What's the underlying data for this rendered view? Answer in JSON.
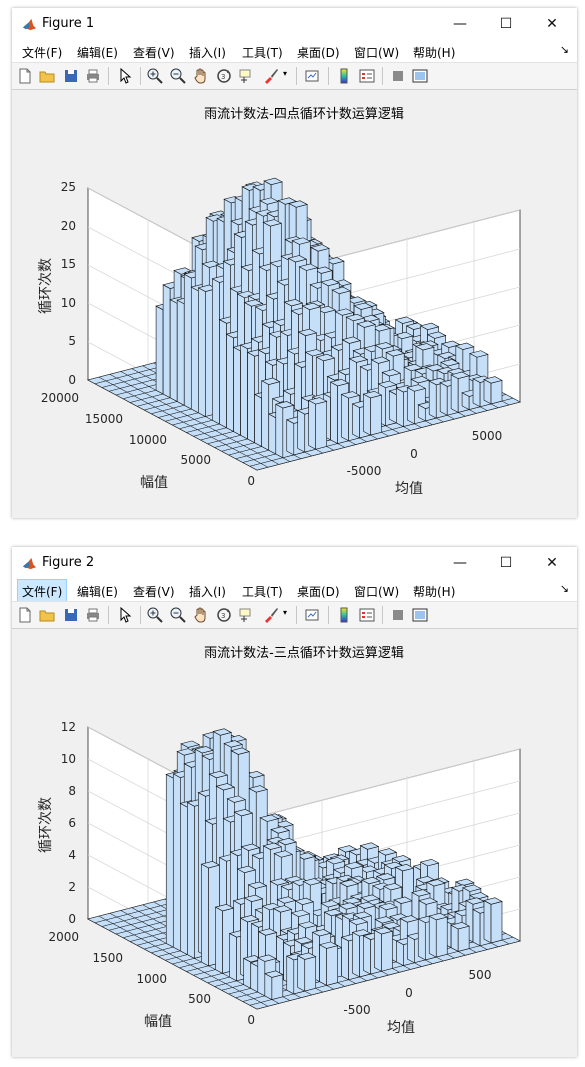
{
  "figures": [
    {
      "window_title": "Figure 1",
      "menu": [
        "文件(F)",
        "编辑(E)",
        "查看(V)",
        "插入(I)",
        "工具(T)",
        "桌面(D)",
        "窗口(W)",
        "帮助(H)"
      ],
      "plot": {
        "title": "雨流计数法-四点循环计数运算逻辑",
        "zlabel": "循环次数",
        "xlabel": "均值",
        "ylabel": "幅值",
        "z_ticks": [
          "0",
          "5",
          "10",
          "15",
          "20",
          "25"
        ],
        "amp_ticks": [
          "20000",
          "15000",
          "10000",
          "5000",
          "0"
        ],
        "mean_ticks": [
          "-5000",
          "0",
          "5000"
        ]
      }
    },
    {
      "window_title": "Figure 2",
      "menu": [
        "文件(F)",
        "编辑(E)",
        "查看(V)",
        "插入(I)",
        "工具(T)",
        "桌面(D)",
        "窗口(W)",
        "帮助(H)"
      ],
      "plot": {
        "title": "雨流计数法-三点循环计数运算逻辑",
        "zlabel": "循环次数",
        "xlabel": "均值",
        "ylabel": "幅值",
        "z_ticks": [
          "0",
          "2",
          "4",
          "6",
          "8",
          "10",
          "12"
        ],
        "amp_ticks": [
          "2000",
          "1500",
          "1000",
          "500",
          "0"
        ],
        "mean_ticks": [
          "-500",
          "0",
          "500"
        ]
      }
    }
  ],
  "toolbar_icons": [
    "new-file-icon",
    "open-folder-icon",
    "save-icon",
    "print-icon",
    "pointer-icon",
    "zoom-in-icon",
    "zoom-out-icon",
    "pan-hand-icon",
    "rotate-3d-icon",
    "data-cursor-icon",
    "brush-icon",
    "link-plot-icon",
    "colorbar-icon",
    "legend-icon",
    "hide-plot-tools-icon",
    "show-plot-tools-icon"
  ],
  "colors": {
    "bar_face": "#c5dff8",
    "bar_edge": "#000000",
    "grid": "#d9d9d9",
    "axes_bg": "#ffffff"
  }
}
